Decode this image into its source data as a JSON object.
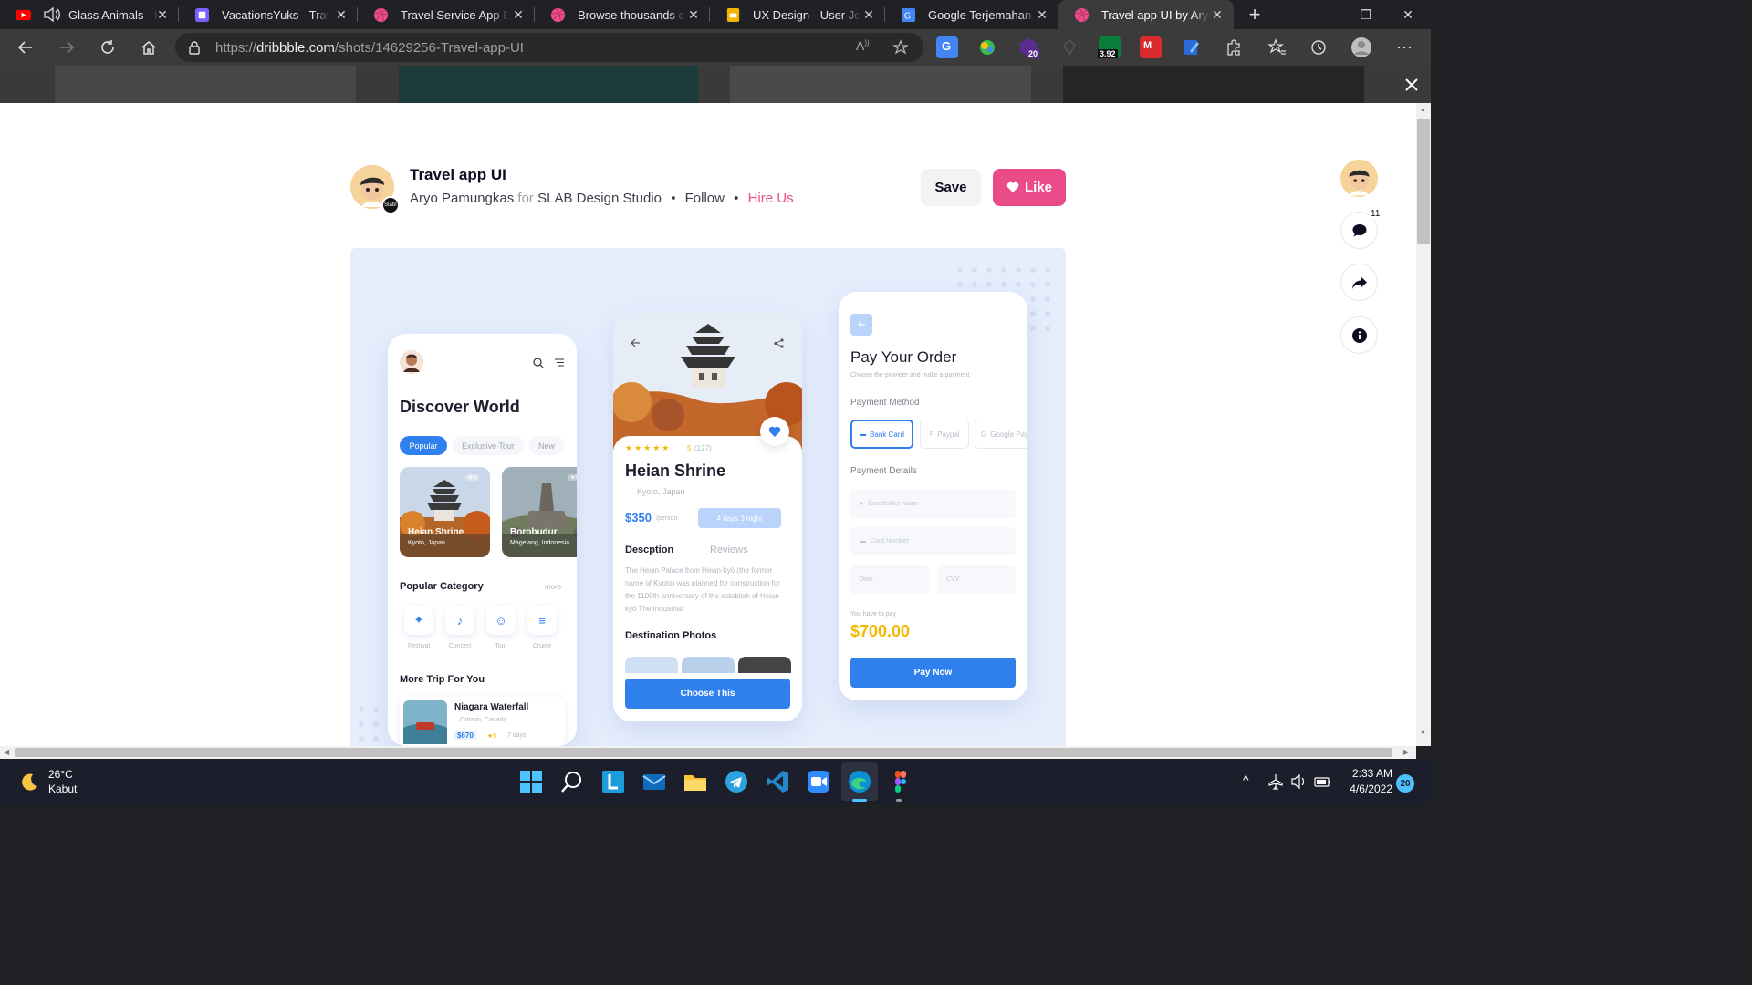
{
  "browser": {
    "tabs": [
      {
        "title": "Glass Animals - Heat Waves",
        "icon": "youtube-icon",
        "audio": true
      },
      {
        "title": "VacationsYuks - Travel",
        "icon": "figma-doc-icon"
      },
      {
        "title": "Travel Service App Design",
        "icon": "dribbble-icon"
      },
      {
        "title": "Browse thousands of Vacation",
        "icon": "dribbble-icon"
      },
      {
        "title": "UX Design - User Journey",
        "icon": "google-slides-icon"
      },
      {
        "title": "Google Terjemahan",
        "icon": "google-translate-icon"
      },
      {
        "title": "Travel app UI by Aryo Pamungkas",
        "icon": "dribbble-icon",
        "active": true
      }
    ],
    "url_prefix": "https://",
    "url_domain": "dribbble.com",
    "url_path": "/shots/14629256-Travel-app-UI",
    "extension_badges": {
      "ext3": "20",
      "ext5": "3.92"
    }
  },
  "shot": {
    "title": "Travel app UI",
    "author": "Aryo Pamungkas",
    "for_word": "for",
    "team": "SLAB Design Studio",
    "follow": "Follow",
    "hire": "Hire Us",
    "dot": "•",
    "team_badge": "Slab!",
    "save_label": "Save",
    "like_label": "Like",
    "comment_count": "11"
  },
  "art": {
    "screen1": {
      "heading": "Discover World",
      "chips": [
        "Popular",
        "Exclusive Tour",
        "New"
      ],
      "cards": [
        {
          "name": "Heian Shrine",
          "location": "Kyoto, Japan",
          "rating": "★5"
        },
        {
          "name": "Borobudur",
          "location": "Magelang, Indonesia",
          "rating": "★5"
        }
      ],
      "category_title": "Popular Category",
      "category_more": "more",
      "categories": [
        "Festival",
        "Concert",
        "Tour",
        "Cruise"
      ],
      "more_title": "More Trip For You",
      "trip": {
        "name": "Niagara Waterfall",
        "location": "Ontario, Canada",
        "price": "$670",
        "rating": "★5",
        "duration": "7 days"
      }
    },
    "screen2": {
      "rating": "5",
      "reviews": "(127)",
      "title": "Heian Shrine",
      "location": "Kyoto, Japan",
      "price": "$350",
      "per": "/person",
      "duration": "4 days 3 night",
      "tab_description": "Descption",
      "tab_reviews": "Reviews",
      "body": "The Heian Palace from Heian-kyō (the former name of Kyoto) was planned for construction for the 1100th anniversary of the establish of Heian-kyō The Industrial",
      "photos_title": "Destination Photos",
      "cta": "Choose This"
    },
    "screen3": {
      "title": "Pay Your Order",
      "subtitle": "Choose the provider and make a payment",
      "method_title": "Payment Method",
      "methods": [
        "Bank Card",
        "Paypal",
        "Google Pay"
      ],
      "details_title": "Payment Details",
      "fields": {
        "holder": "Cardholder Name",
        "number": "Card Number",
        "date": "Date",
        "cvv": "CVV"
      },
      "have_to_pay": "You have to pay",
      "amount": "$700.00",
      "cta": "Pay Now"
    }
  },
  "taskbar": {
    "weather_temp": "26°C",
    "weather_desc": "Kabut",
    "time": "2:33 AM",
    "date": "4/6/2022",
    "notifications": "20"
  },
  "colors": {
    "dribbble_pink": "#ea4c89",
    "app_blue": "#2f80ed",
    "price_gold": "#f5b800"
  }
}
